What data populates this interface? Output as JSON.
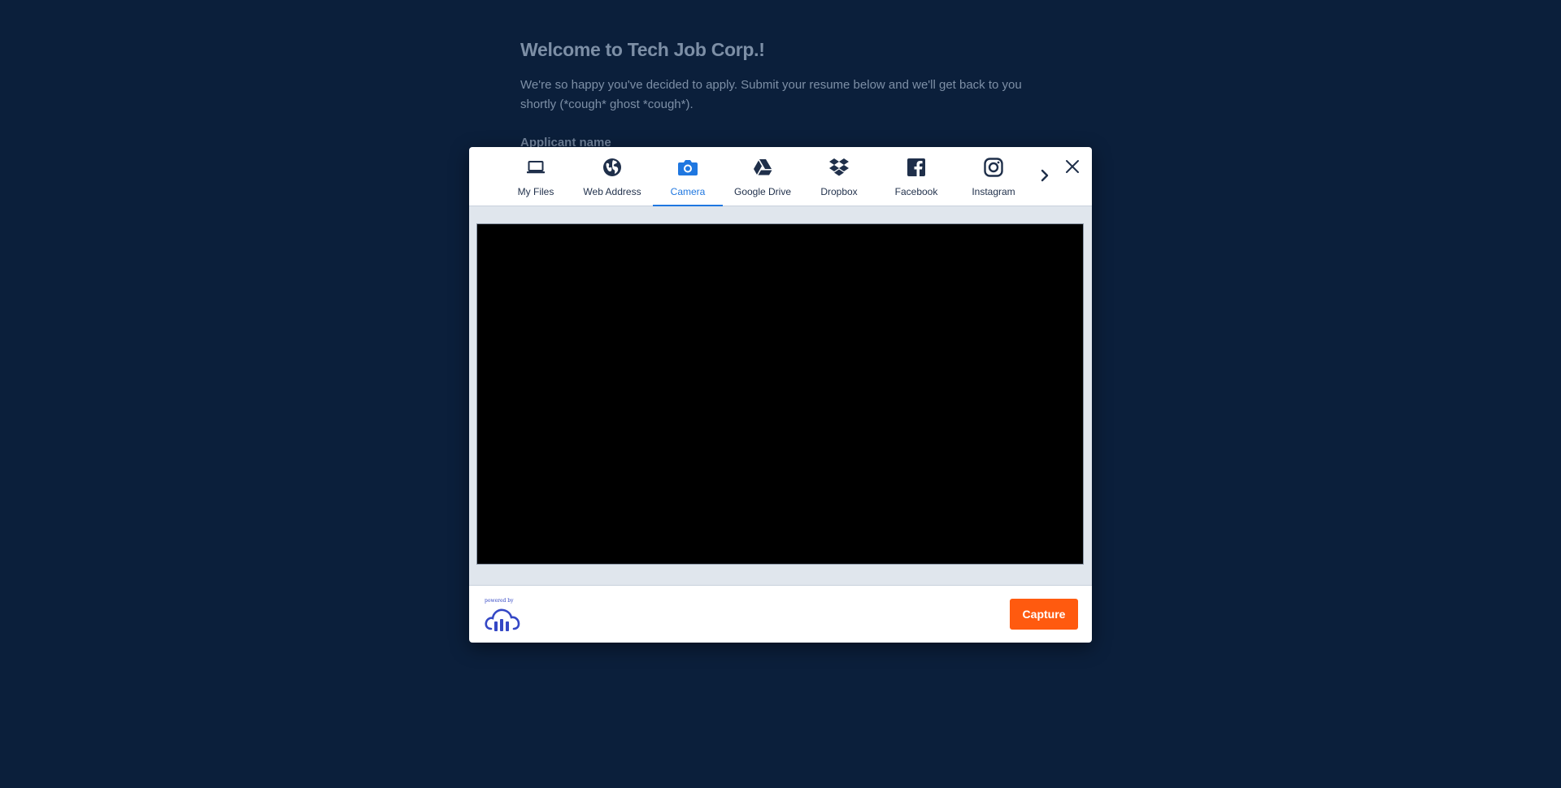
{
  "page": {
    "title": "Welcome to Tech Job Corp.!",
    "intro": "We're so happy you've decided to apply. Submit your resume below and we'll get back to you shortly (*cough* ghost *cough*).",
    "field_label": "Applicant name"
  },
  "picker": {
    "tabs": [
      {
        "label": "My Files",
        "icon": "laptop-icon"
      },
      {
        "label": "Web Address",
        "icon": "globe-icon"
      },
      {
        "label": "Camera",
        "icon": "camera-icon",
        "active": true
      },
      {
        "label": "Google Drive",
        "icon": "google-drive-icon"
      },
      {
        "label": "Dropbox",
        "icon": "dropbox-icon"
      },
      {
        "label": "Facebook",
        "icon": "facebook-icon"
      },
      {
        "label": "Instagram",
        "icon": "instagram-icon"
      }
    ],
    "capture_label": "Capture",
    "powered_by": "powered by",
    "colors": {
      "accent": "#1f77e0",
      "capture": "#ff5a0f",
      "background": "#0b1f3b"
    }
  }
}
